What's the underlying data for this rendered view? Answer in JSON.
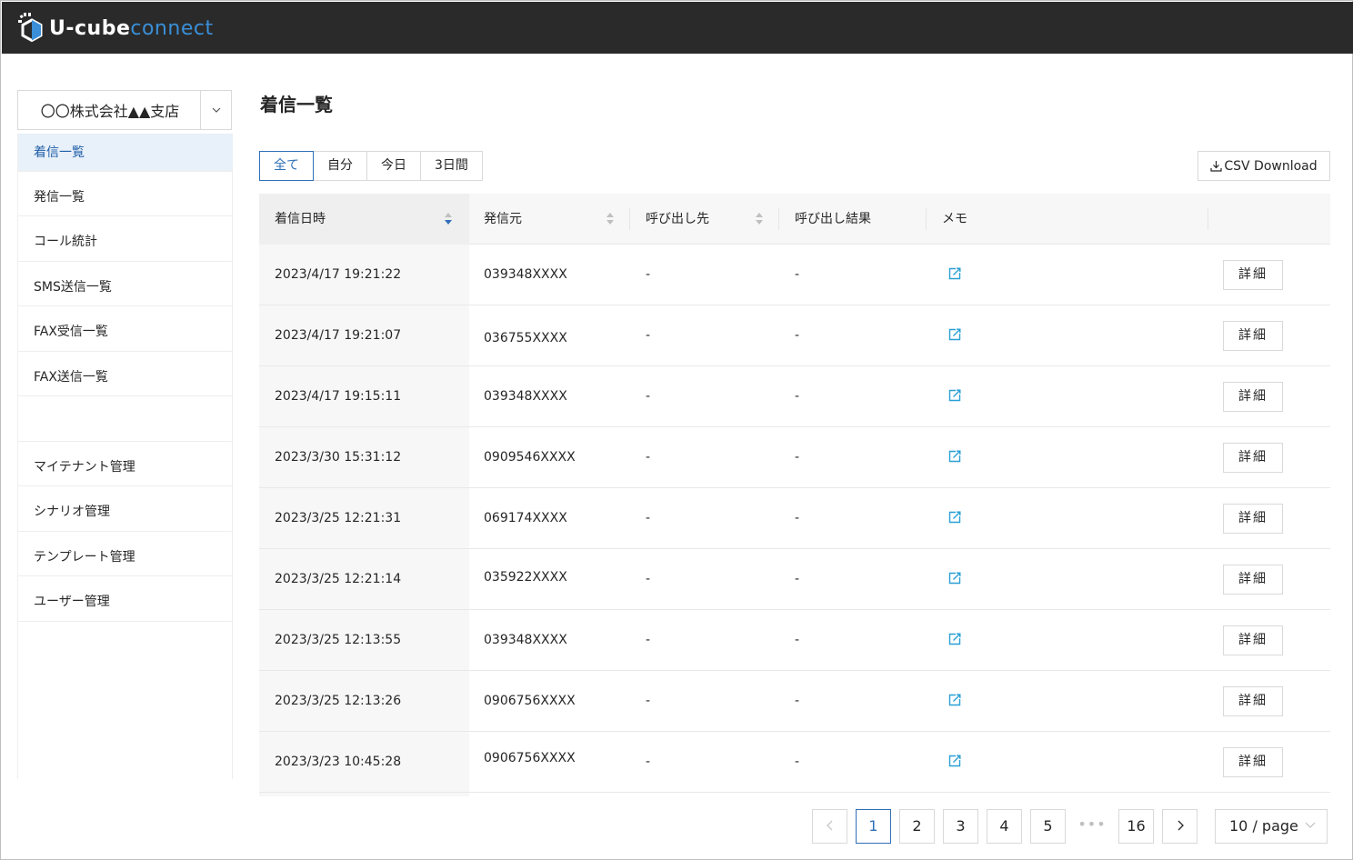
{
  "header": {
    "logo_part1": "U-cube",
    "logo_part2": "connect"
  },
  "sidebar": {
    "tenant_selected": "〇〇株式会社▲▲支店",
    "items": [
      {
        "label": "着信一覧",
        "active": true
      },
      {
        "label": "発信一覧",
        "active": false
      },
      {
        "label": "コール統計",
        "active": false
      },
      {
        "label": "SMS送信一覧",
        "active": false
      },
      {
        "label": "FAX受信一覧",
        "active": false
      },
      {
        "label": "FAX送信一覧",
        "active": false
      },
      {
        "label": "",
        "active": false
      },
      {
        "label": "マイテナント管理",
        "active": false
      },
      {
        "label": "シナリオ管理",
        "active": false
      },
      {
        "label": "テンプレート管理",
        "active": false
      },
      {
        "label": "ユーザー管理",
        "active": false
      }
    ]
  },
  "main": {
    "title": "着信一覧",
    "filters": [
      "全て",
      "自分",
      "今日",
      "3日間"
    ],
    "active_filter": "全て",
    "csv_label": "CSV Download",
    "table": {
      "columns": [
        "着信日時",
        "発信元",
        "呼び出し先",
        "呼び出し結果",
        "メモ",
        ""
      ],
      "detail_label": "詳細",
      "rows": [
        {
          "datetime": "2023/4/17 19:21:22",
          "from": "039348XXXX",
          "to": "-",
          "result": "-"
        },
        {
          "datetime": "2023/4/17 19:21:07",
          "from": "036755XXXX",
          "to": "-",
          "result": "-"
        },
        {
          "datetime": "2023/4/17 19:15:11",
          "from": "039348XXXX",
          "to": "-",
          "result": "-"
        },
        {
          "datetime": "2023/3/30 15:31:12",
          "from": "0909546XXXX",
          "to": "-",
          "result": "-"
        },
        {
          "datetime": "2023/3/25 12:21:31",
          "from": "069174XXXX",
          "to": "-",
          "result": "-"
        },
        {
          "datetime": "2023/3/25 12:21:14",
          "from": "035922XXXX",
          "to": "-",
          "result": "-"
        },
        {
          "datetime": "2023/3/25 12:13:55",
          "from": "039348XXXX",
          "to": "-",
          "result": "-"
        },
        {
          "datetime": "2023/3/25 12:13:26",
          "from": "0906756XXXX",
          "to": "-",
          "result": "-"
        },
        {
          "datetime": "2023/3/23 10:45:28",
          "from": "0906756XXXX",
          "to": "-",
          "result": "-"
        }
      ]
    },
    "pagination": {
      "prev": "<",
      "pages": [
        "1",
        "2",
        "3",
        "4",
        "5"
      ],
      "ellipsis": "•••",
      "last": "16",
      "next": ">",
      "current": "1",
      "page_size": "10 / page"
    }
  },
  "colors": {
    "accent": "#2f6fb8",
    "topbar": "#2a2a2a",
    "memo_icon": "#2a9fd6",
    "sidebar_active_bg": "#e8f0f9"
  }
}
